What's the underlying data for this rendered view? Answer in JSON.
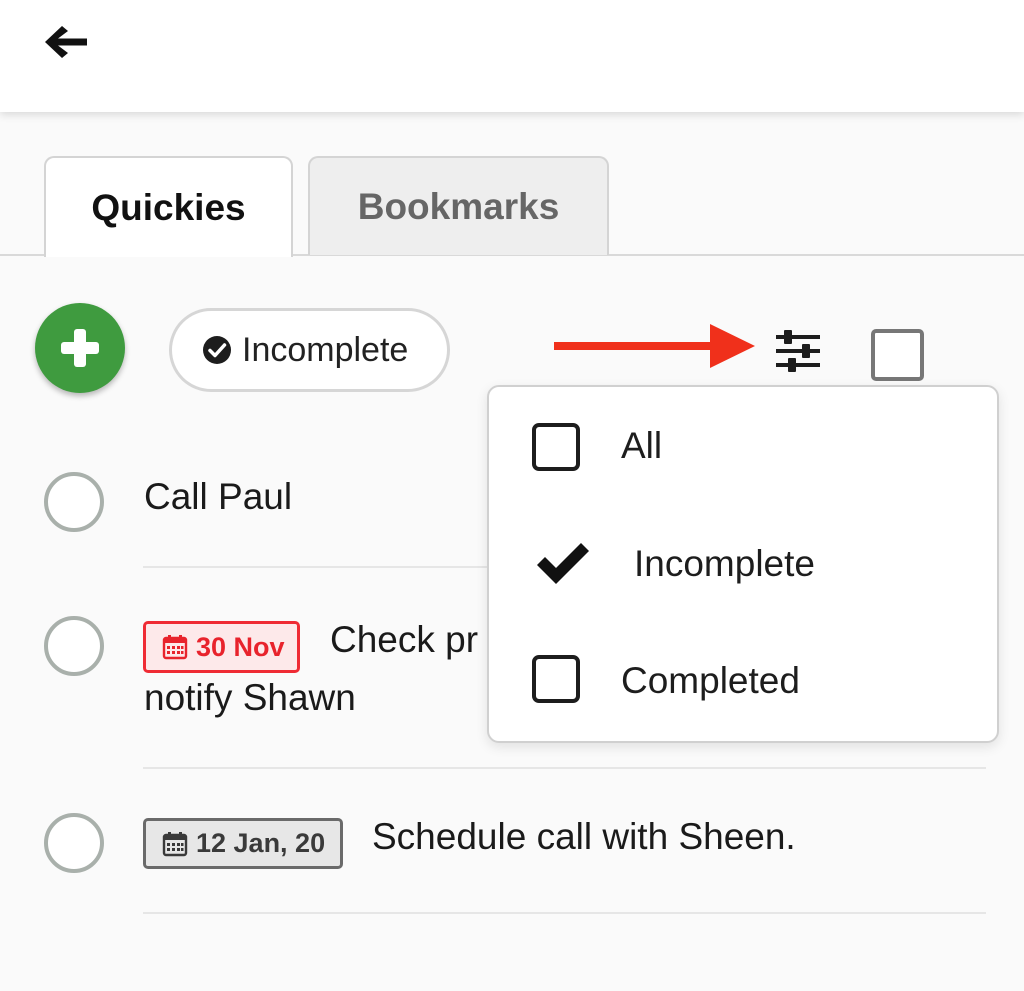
{
  "app_bar": {
    "back_icon": "arrow-left-icon"
  },
  "tabs": [
    {
      "label": "Quickies",
      "active": true
    },
    {
      "label": "Bookmarks",
      "active": false
    }
  ],
  "toolbar": {
    "add_icon": "plus-icon",
    "add_color": "#3f9b3f",
    "filter_chip": {
      "icon": "check-circle-icon",
      "label": "Incomplete"
    },
    "annotation_arrow_color": "#f0301b",
    "filter_icon": "sliders-icon",
    "select_all_icon": "checkbox-empty-icon"
  },
  "tasks": [
    {
      "text": "Call Paul",
      "completed": false
    },
    {
      "date": "30 Nov",
      "date_style": "overdue",
      "text_line1": "Check pr",
      "text_line2": "notify Shawn",
      "completed": false
    },
    {
      "date": "12 Jan, 20",
      "date_style": "upcoming",
      "text": "Schedule call with Sheen.",
      "completed": false
    }
  ],
  "filter_menu": {
    "items": [
      {
        "label": "All",
        "selected": false
      },
      {
        "label": "Incomplete",
        "selected": true
      },
      {
        "label": "Completed",
        "selected": false
      }
    ]
  },
  "colors": {
    "overdue": "#e8232c",
    "overdue_bg": "#fde9ea",
    "upcoming": "#3a3a3a",
    "upcoming_bg": "#e7e7e7"
  }
}
